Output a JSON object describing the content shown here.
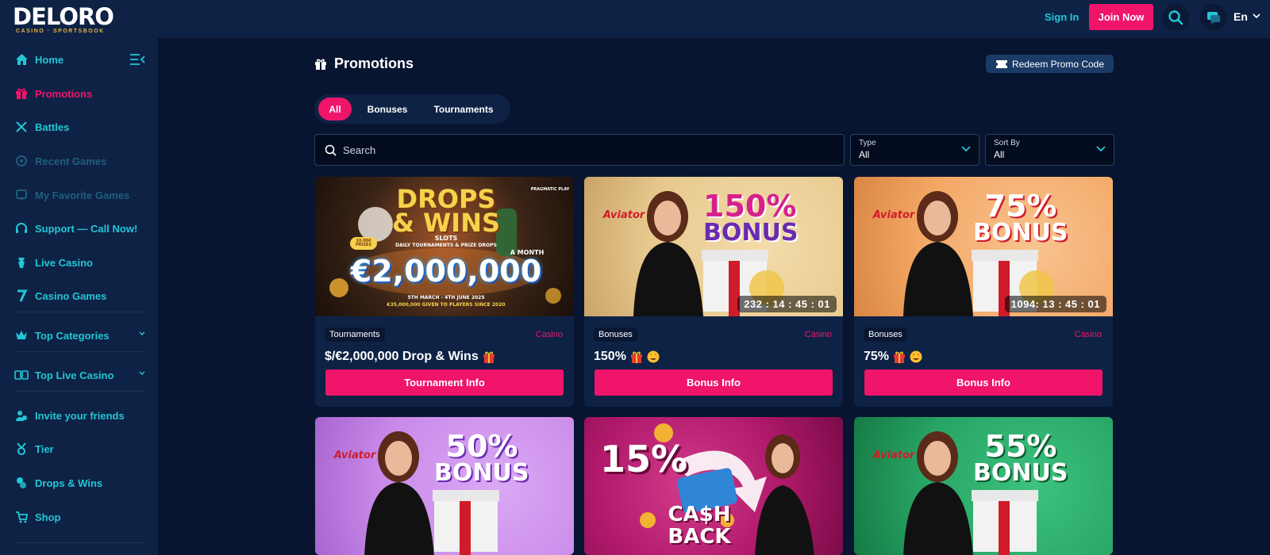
{
  "header": {
    "logo": "DELORO",
    "logo_sub": "CASINO · SPORTSBOOK",
    "sign_in": "Sign In",
    "join_now": "Join Now",
    "language": "En"
  },
  "sidebar": {
    "items": [
      {
        "label": "Home",
        "icon": "home-icon"
      },
      {
        "label": "Promotions",
        "icon": "gift-icon",
        "active": true
      },
      {
        "label": "Battles",
        "icon": "swords-icon"
      },
      {
        "label": "Recent Games",
        "icon": "recent-icon",
        "disabled": true
      },
      {
        "label": "My Favorite Games",
        "icon": "heart-icon",
        "disabled": true
      },
      {
        "label": "Support — Call Now!",
        "icon": "headset-icon"
      },
      {
        "label": "Live Casino",
        "icon": "live-casino-icon"
      },
      {
        "label": "Casino Games",
        "icon": "seven-icon"
      },
      {
        "label": "Top Categories",
        "icon": "crown-icon"
      },
      {
        "label": "Top Live Casino",
        "icon": "cards-icon"
      },
      {
        "label": "Invite your friends",
        "icon": "invite-icon"
      },
      {
        "label": "Tier",
        "icon": "medal-icon"
      },
      {
        "label": "Drops & Wins",
        "icon": "coins-icon"
      },
      {
        "label": "Shop",
        "icon": "cart-icon"
      }
    ]
  },
  "main": {
    "title": "Promotions",
    "redeem_label": "Redeem Promo Code",
    "tabs": [
      "All",
      "Bonuses",
      "Tournaments"
    ],
    "search_placeholder": "Search",
    "filters": [
      {
        "label": "Type",
        "value": "All"
      },
      {
        "label": "Sort By",
        "value": "All"
      }
    ]
  },
  "cards": [
    {
      "tag": "Tournaments",
      "category": "Casino",
      "title": "$/€2,000,000 Drop & Wins",
      "cta": "Tournament Info",
      "banner": {
        "line1": "DROPS",
        "line2": "& WINS",
        "sub1": "SLOTS",
        "sub2": "DAILY TOURNAMENTS & PRIZE DROPS",
        "month": "A MONTH",
        "amount": "€2,000,000",
        "dates": "5TH MARCH - 4TH JUNE 2025",
        "given": "€35,000,000 GIVEN TO PLAYERS SINCE 2020",
        "provider": "PRAGMATIC PLAY",
        "prize_badge": "10,000 PRIZES"
      },
      "bg": "#3a2416"
    },
    {
      "tag": "Bonuses",
      "category": "Casino",
      "title": "150%",
      "cta": "Bonus Info",
      "banner": {
        "pct": "150%",
        "word": "BONUS",
        "brand": "Aviator",
        "timer": "232 : 14 : 45 : 01"
      },
      "bg": "#e7c98f"
    },
    {
      "tag": "Bonuses",
      "category": "Casino",
      "title": "75%",
      "cta": "Bonus Info",
      "banner": {
        "pct": "75%",
        "word": "BONUS",
        "brand": "Aviator",
        "timer": "1094: 13 : 45 : 01"
      },
      "bg": "#f3a765"
    },
    {
      "banner": {
        "pct": "50%",
        "word": "BONUS",
        "brand": "Aviator"
      },
      "bg": "#c98ae9"
    },
    {
      "banner": {
        "pct": "15%",
        "word1": "CA$H",
        "word2": "BACK"
      },
      "bg": "#b0196a"
    },
    {
      "banner": {
        "pct": "55%",
        "word": "BONUS",
        "brand": "Aviator"
      },
      "bg": "#27a363"
    }
  ]
}
